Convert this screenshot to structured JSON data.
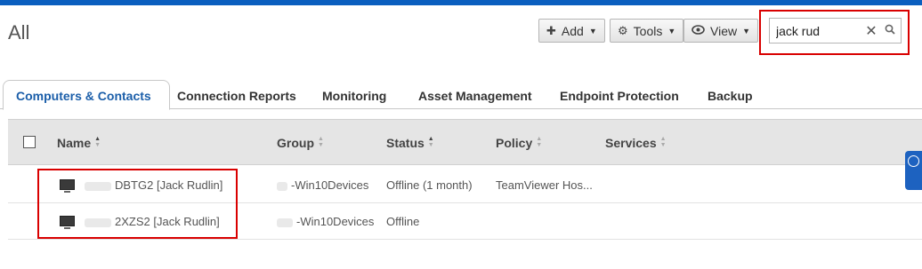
{
  "header": {
    "title": "All",
    "add_label": "Add",
    "tools_label": "Tools",
    "view_label": "View"
  },
  "search": {
    "value": "jack rud",
    "placeholder": ""
  },
  "tabs": [
    {
      "label": "Computers & Contacts",
      "active": true
    },
    {
      "label": "Connection Reports",
      "active": false
    },
    {
      "label": "Monitoring",
      "active": false
    },
    {
      "label": "Asset Management",
      "active": false
    },
    {
      "label": "Endpoint Protection",
      "active": false
    },
    {
      "label": "Backup",
      "active": false
    }
  ],
  "columns": {
    "name": "Name",
    "group": "Group",
    "status": "Status",
    "policy": "Policy",
    "services": "Services"
  },
  "rows": [
    {
      "name": "DBTG2 [Jack Rudlin]",
      "group": "-Win10Devices",
      "status": "Offline (1 month)",
      "policy": "TeamViewer Hos..."
    },
    {
      "name": "2XZS2 [Jack Rudlin]",
      "group": "-Win10Devices",
      "status": "Offline",
      "policy": ""
    }
  ],
  "colors": {
    "accent": "#0b5fbf",
    "highlight": "#d90000",
    "active_tab_text": "#1b5ea9"
  },
  "icons": [
    "plus-icon",
    "gear-icon",
    "eye-icon",
    "close-icon",
    "search-icon",
    "monitor-icon",
    "help-icon"
  ]
}
